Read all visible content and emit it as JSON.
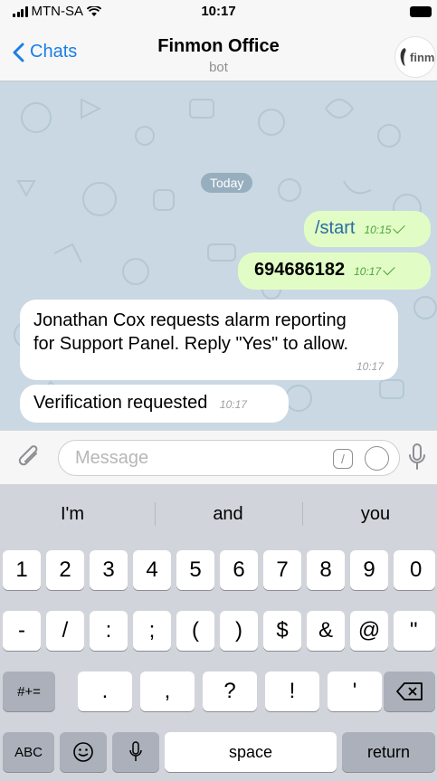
{
  "status": {
    "carrier": "MTN-SA",
    "time": "10:17"
  },
  "nav": {
    "back_label": "Chats",
    "title": "Finmon Office",
    "subtitle": "bot",
    "avatar_text": "finm"
  },
  "chat": {
    "date_label": "Today",
    "messages": [
      {
        "direction": "out",
        "text": "/start",
        "time": "10:15"
      },
      {
        "direction": "out",
        "text": "694686182",
        "time": "10:17"
      },
      {
        "direction": "in",
        "line1": "Jonathan Cox requests alarm reporting",
        "line2": "for Support Panel. Reply \"Yes\" to allow.",
        "time": "10:17"
      },
      {
        "direction": "in",
        "text": "Verification requested",
        "time": "10:17"
      }
    ]
  },
  "input": {
    "placeholder": "Message",
    "slash_label": "/"
  },
  "keyboard": {
    "suggestions": [
      "I'm",
      "and",
      "you"
    ],
    "row1": [
      "1",
      "2",
      "3",
      "4",
      "5",
      "6",
      "7",
      "8",
      "9",
      "0"
    ],
    "row2": [
      "-",
      "/",
      ":",
      ";",
      "(",
      ")",
      "$",
      "&",
      "@",
      "\""
    ],
    "row3": [
      ".",
      ",",
      "?",
      "!",
      "'"
    ],
    "symbols_label": "#+=",
    "abc_label": "ABC",
    "space_label": "space",
    "return_label": "return"
  },
  "colors": {
    "accent": "#1a7ee6",
    "outgoing_bubble": "#e1fdc5",
    "incoming_bubble": "#ffffff",
    "chat_bg": "#c9d8e3",
    "keyboard_bg": "#d1d4da"
  }
}
